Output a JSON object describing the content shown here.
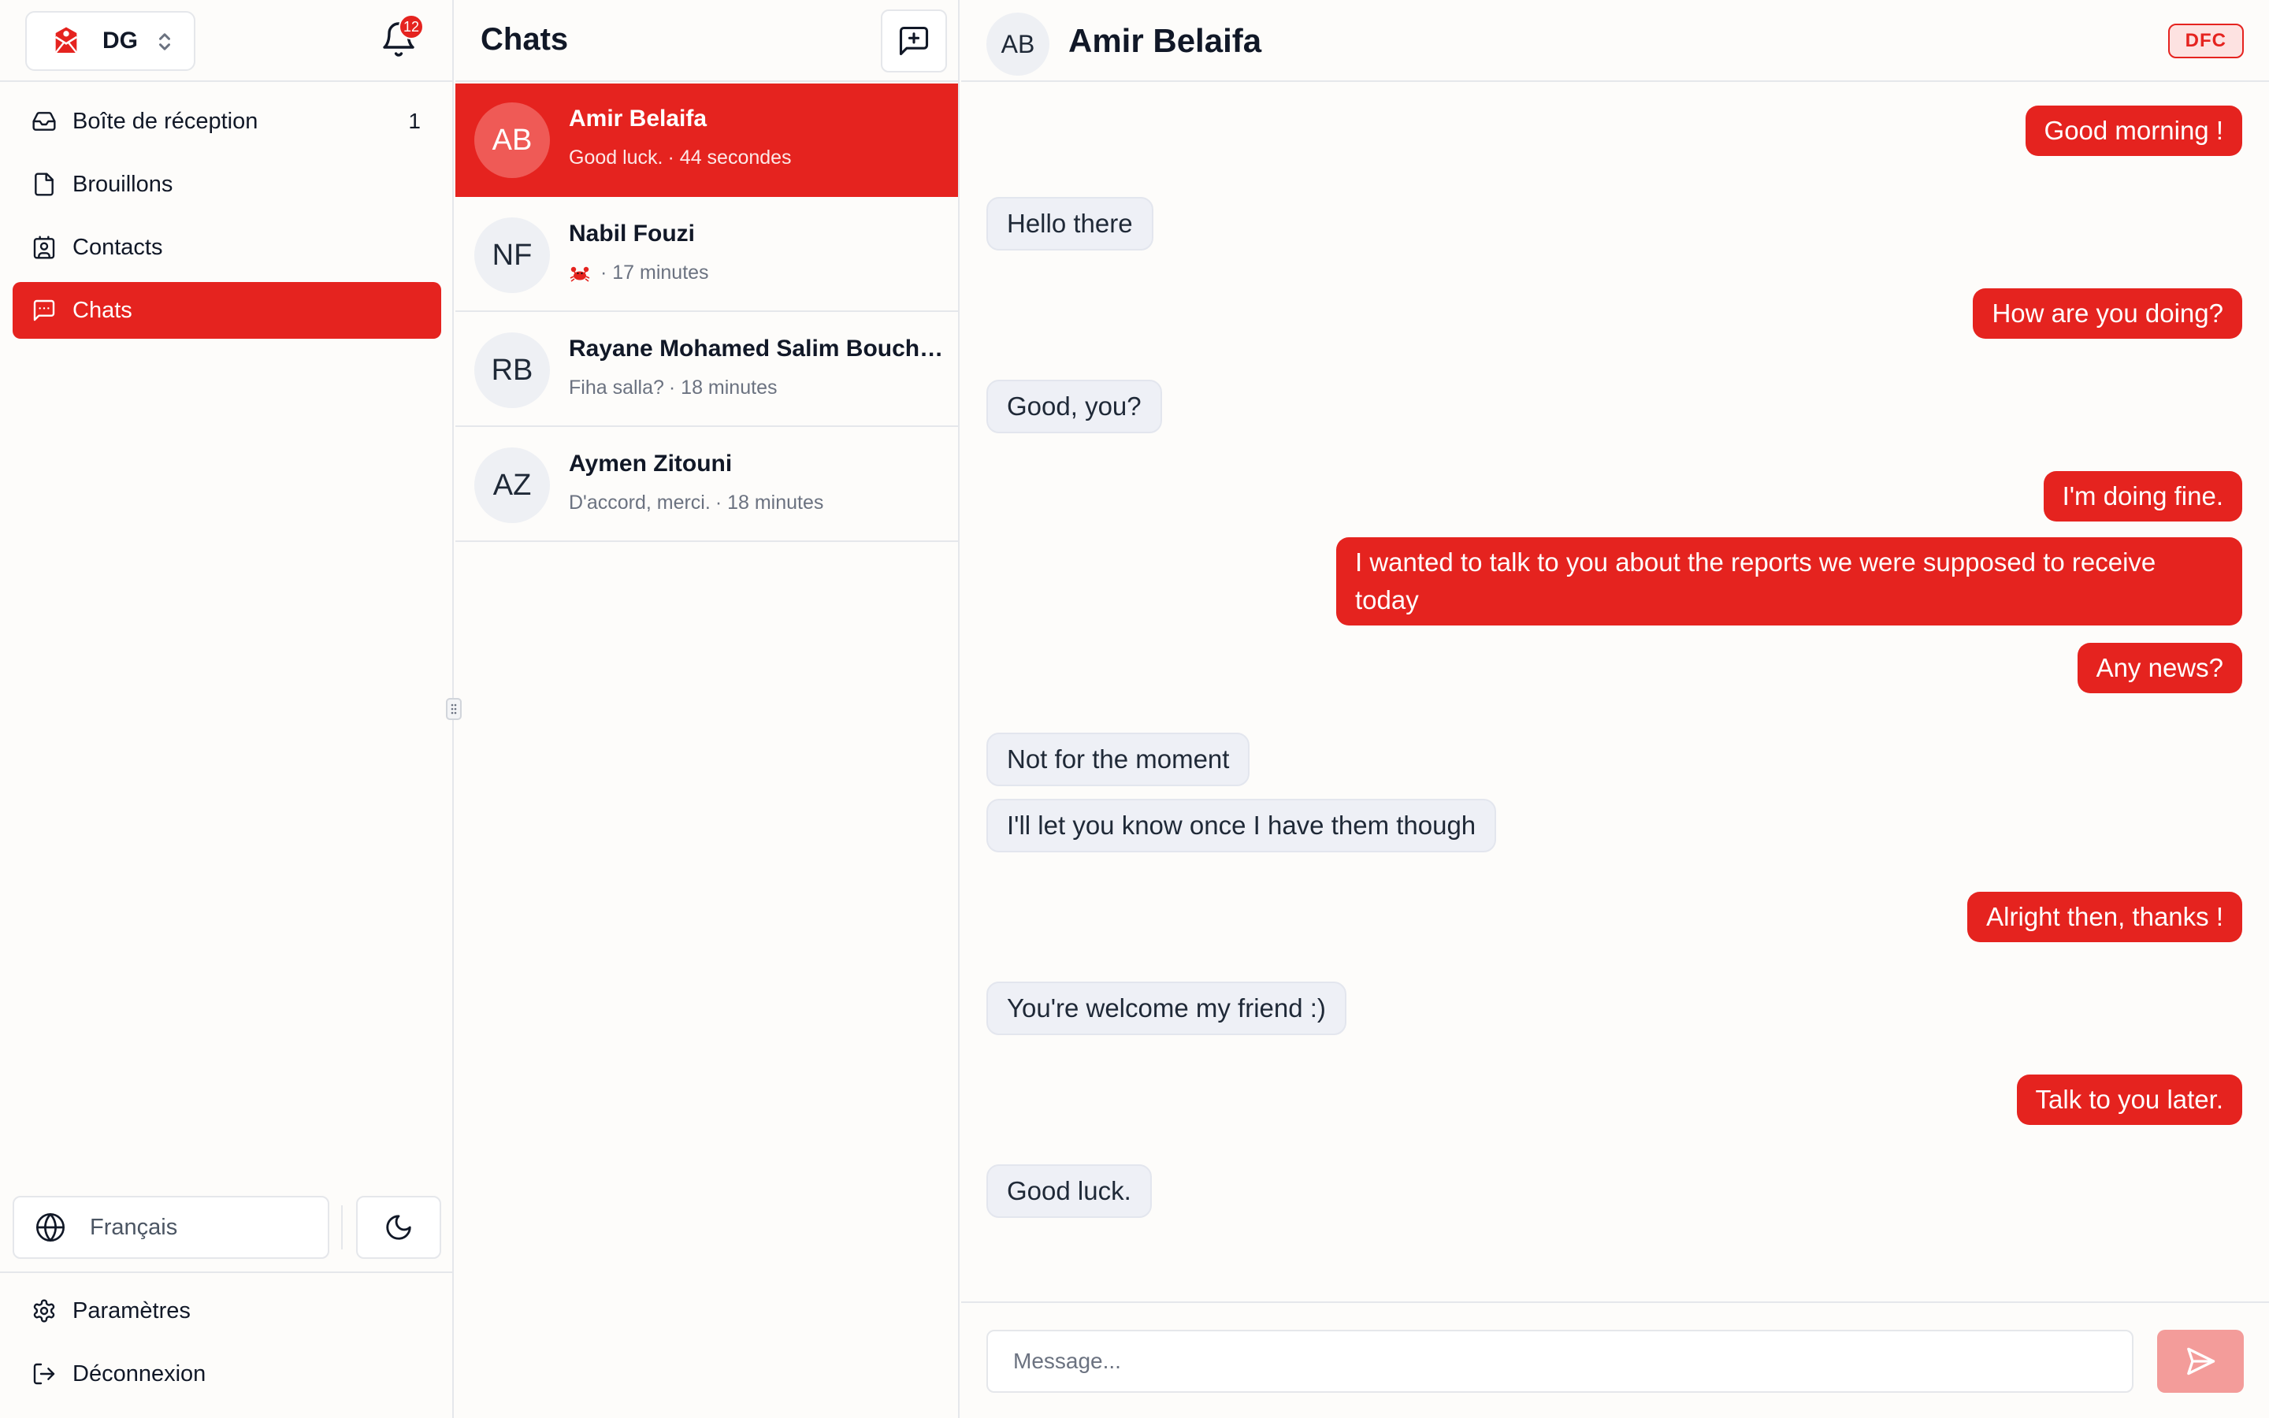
{
  "colors": {
    "accent": "#e5231f",
    "accent_soft": "#f39c9a",
    "bubble_in": "#eef0f6",
    "border": "#e5e7eb"
  },
  "sidebar": {
    "org": {
      "name": "DG",
      "logo_icon": "mail-shield-logo-icon",
      "chevron_icon": "chevron-up-down-icon"
    },
    "notifications": {
      "icon": "bell-icon",
      "count": "12"
    },
    "nav": [
      {
        "label": "Boîte de réception",
        "icon": "inbox-icon",
        "count": "1"
      },
      {
        "label": "Brouillons",
        "icon": "file-icon"
      },
      {
        "label": "Contacts",
        "icon": "contact-book-icon"
      },
      {
        "label": "Chats",
        "icon": "message-square-icon",
        "active": true
      }
    ],
    "language": {
      "label": "Français",
      "icon": "globe-icon"
    },
    "theme_toggle": {
      "icon": "moon-icon"
    },
    "footer": [
      {
        "label": "Paramètres",
        "icon": "gear-icon"
      },
      {
        "label": "Déconnexion",
        "icon": "logout-icon"
      }
    ]
  },
  "chat_list": {
    "title": "Chats",
    "new_chat_icon": "message-plus-icon",
    "conversations": [
      {
        "initials": "AB",
        "name": "Amir Belaifa",
        "preview": "Good luck.",
        "time": "· 44 secondes",
        "active": true
      },
      {
        "initials": "NF",
        "name": "Nabil Fouzi",
        "preview": "",
        "preview_icon": "crab-emoji-icon",
        "time": "· 17 minutes"
      },
      {
        "initials": "RB",
        "name": "Rayane Mohamed Salim Bouchareb",
        "preview": "Fiha salla?",
        "time": "· 18 minutes"
      },
      {
        "initials": "AZ",
        "name": "Aymen Zitouni",
        "preview": "D'accord, merci.",
        "time": "· 18 minutes"
      }
    ]
  },
  "conversation": {
    "contact": {
      "initials": "AB",
      "name": "Amir Belaifa",
      "tag": "DFC"
    },
    "messages": [
      {
        "dir": "out",
        "text": "Good morning !"
      },
      {
        "dir": "in",
        "text": "Hello there"
      },
      {
        "dir": "out",
        "text": "How are you doing?"
      },
      {
        "dir": "in",
        "text": "Good, you?"
      },
      {
        "dir": "out",
        "text": "I'm doing fine."
      },
      {
        "dir": "out",
        "text": "I wanted to talk to you about the reports we were supposed to receive today"
      },
      {
        "dir": "out",
        "text": "Any news?"
      },
      {
        "dir": "in",
        "text": "Not for the moment"
      },
      {
        "dir": "in",
        "text": "I'll let you know once I have them though"
      },
      {
        "dir": "out",
        "text": "Alright then, thanks !"
      },
      {
        "dir": "in",
        "text": "You're welcome my friend :)"
      },
      {
        "dir": "out",
        "text": "Talk to you later."
      },
      {
        "dir": "in",
        "text": "Good luck."
      }
    ],
    "composer": {
      "placeholder": "Message...",
      "send_icon": "send-icon"
    }
  }
}
